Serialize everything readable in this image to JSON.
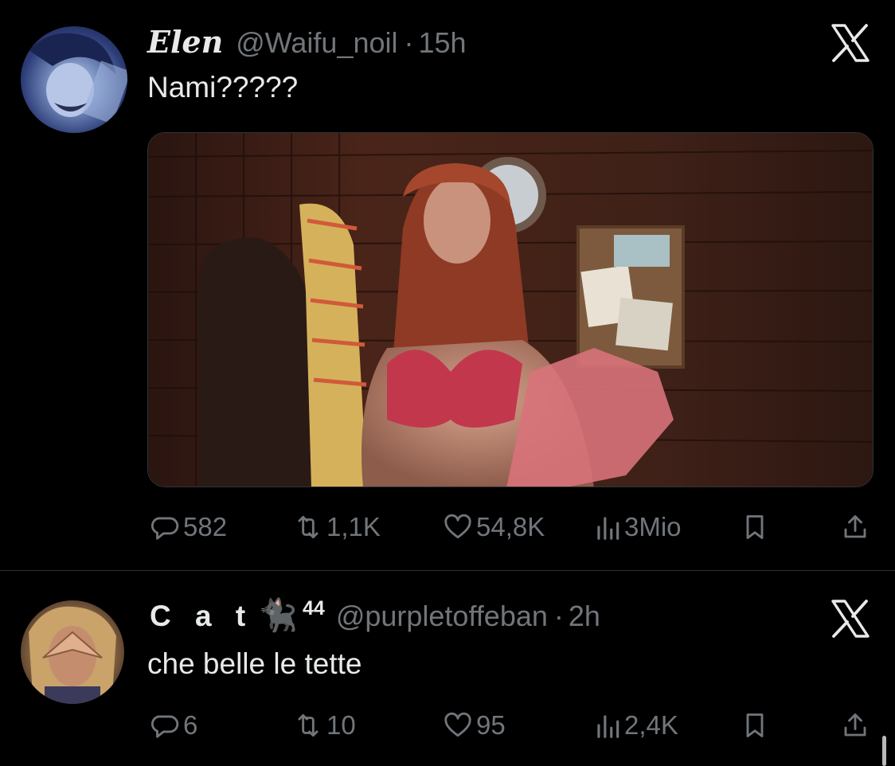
{
  "tweets": [
    {
      "display_name": "Elen",
      "handle": "@Waifu_noil",
      "separator": "·",
      "time": "15h",
      "text": "Nami?????",
      "has_media": true,
      "stats": {
        "replies": "582",
        "reposts": "1,1K",
        "likes": "54,8K",
        "views": "3Mio"
      }
    },
    {
      "display_name": "C a t",
      "emoji": "🐈‍⬛",
      "superscript": "44",
      "handle": "@purpletoffeban",
      "separator": "·",
      "time": "2h",
      "text": "che belle le tette",
      "has_media": false,
      "stats": {
        "replies": "6",
        "reposts": "10",
        "likes": "95",
        "views": "2,4K"
      }
    }
  ],
  "icons": {
    "reply": "reply-icon",
    "repost": "repost-icon",
    "like": "heart-icon",
    "views": "views-icon",
    "bookmark": "bookmark-icon",
    "share": "share-icon",
    "brand": "x-logo-icon"
  },
  "colors": {
    "background": "#000000",
    "text": "#e7e9ea",
    "muted": "#71767b",
    "divider": "#2f3336"
  }
}
